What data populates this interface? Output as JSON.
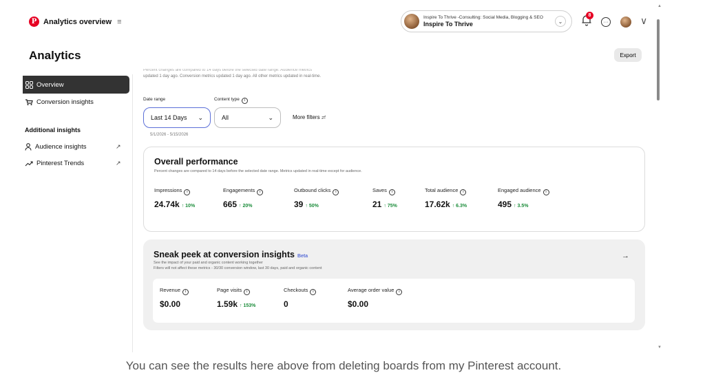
{
  "app": {
    "title": "Analytics overview",
    "menu_icon": "≡"
  },
  "account": {
    "subtitle": "Inspire To Thrive -Consulting: Social Media, Blogging & SEO",
    "name": "Inspire To Thrive"
  },
  "notifications": {
    "count": "8"
  },
  "page": {
    "title": "Analytics",
    "export_label": "Export"
  },
  "sidebar": {
    "items": [
      {
        "label": "Overview",
        "icon": "grid-icon"
      },
      {
        "label": "Conversion insights",
        "icon": "cart-icon"
      }
    ],
    "section_title": "Additional insights",
    "extra_items": [
      {
        "label": "Audience insights",
        "icon": "person-icon"
      },
      {
        "label": "Pinterest Trends",
        "icon": "trend-icon"
      }
    ]
  },
  "notice": {
    "line1": "Percent changes are compared to 14 days before the selected date range. Audience metrics",
    "line2": "updated 1 day ago. Conversion metrics updated 1 day ago. All other metrics updated in real-time."
  },
  "filters": {
    "date_label": "Date range",
    "date_value": "Last 14 Days",
    "content_label": "Content type",
    "content_value": "All",
    "more_filters": "More filters",
    "date_sub": "5/1/2026 - 5/15/2026"
  },
  "overall": {
    "title": "Overall performance",
    "subtitle": "Percent changes are compared to 14 days before the selected date range. Metrics updated in real-time except for audience.",
    "metrics": [
      {
        "label": "Impressions",
        "value": "24.74k",
        "delta": "10%"
      },
      {
        "label": "Engagements",
        "value": "665",
        "delta": "20%"
      },
      {
        "label": "Outbound clicks",
        "value": "39",
        "delta": "50%"
      },
      {
        "label": "Saves",
        "value": "21",
        "delta": "75%"
      },
      {
        "label": "Total audience",
        "value": "17.62k",
        "delta": "6.3%"
      },
      {
        "label": "Engaged audience",
        "value": "495",
        "delta": "3.5%"
      }
    ]
  },
  "conversion": {
    "title": "Sneak peek at conversion insights",
    "beta": "Beta",
    "sub1": "See the impact of your paid and organic content working together",
    "sub2": "Filters will not affect these metrics - 30/30 conversion window, last 30 days, paid and organic content",
    "metrics": [
      {
        "label": "Revenue",
        "value": "$0.00",
        "delta": ""
      },
      {
        "label": "Page visits",
        "value": "1.59k",
        "delta": "153%"
      },
      {
        "label": "Checkouts",
        "value": "0",
        "delta": ""
      },
      {
        "label": "Average order value",
        "value": "$0.00",
        "delta": ""
      }
    ]
  },
  "caption": "You can see the results here above from deleting boards from my Pinterest account."
}
